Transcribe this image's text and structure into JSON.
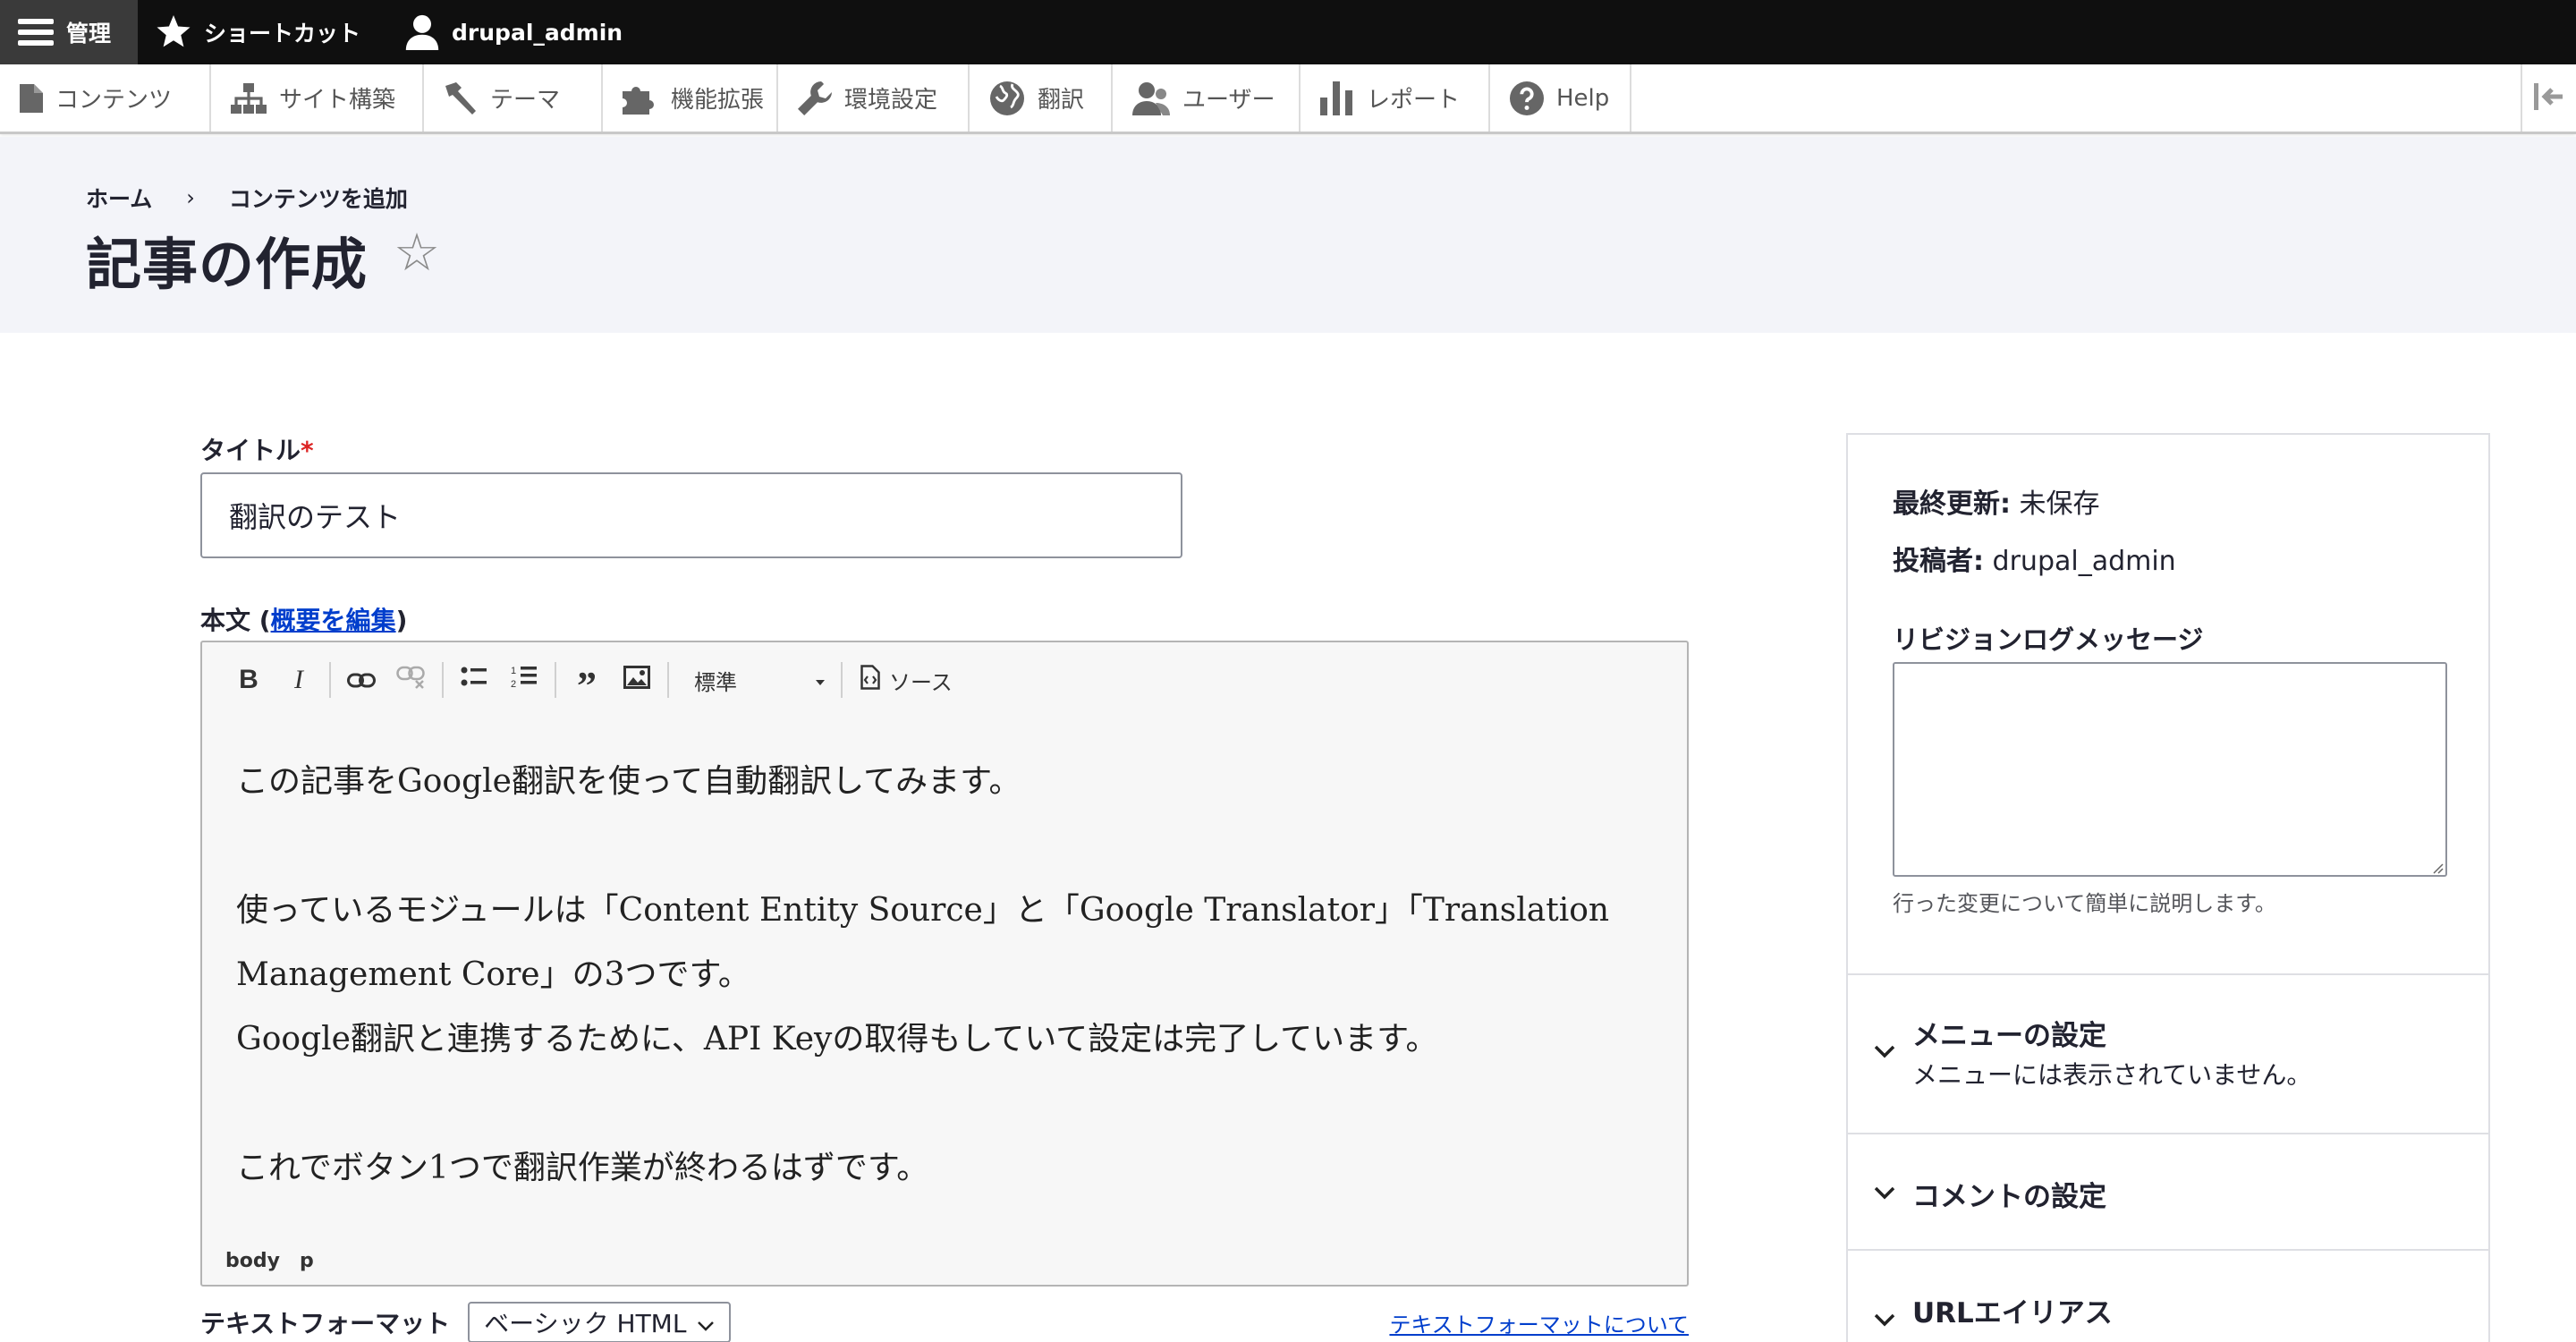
{
  "toolbar_bar": {
    "manage_label": "管理",
    "shortcuts_label": "ショートカット",
    "user_label": "drupal_admin"
  },
  "tray": {
    "items": [
      {
        "label": "コンテンツ",
        "icon": "file-icon"
      },
      {
        "label": "サイト構築",
        "icon": "sitemap-icon"
      },
      {
        "label": "テーマ",
        "icon": "paintbrush-icon"
      },
      {
        "label": "機能拡張",
        "icon": "puzzle-icon"
      },
      {
        "label": "環境設定",
        "icon": "wrench-icon"
      },
      {
        "label": "翻訳",
        "icon": "globe-icon"
      },
      {
        "label": "ユーザー",
        "icon": "people-icon"
      },
      {
        "label": "レポート",
        "icon": "bar-chart-icon"
      },
      {
        "label": "Help",
        "icon": "help-icon"
      }
    ]
  },
  "header": {
    "breadcrumb": [
      "ホーム",
      "コンテンツを追加"
    ],
    "breadcrumb_sep": "›",
    "title": "記事の作成",
    "star": "☆"
  },
  "form": {
    "title_label": "タイトル",
    "required_mark": "*",
    "title_value": "翻訳のテスト",
    "body_label_prefix": "本文 (",
    "body_label_link": "概要を編集",
    "body_label_suffix": ")",
    "editor": {
      "heading_select": "標準",
      "source_label": "ソース",
      "paragraphs": [
        "この記事をGoogle翻訳を使って自動翻訳してみます。",
        "使っているモジュールは「Content Entity Source」と「Google Translator」「Translation Management Core」の3つです。",
        "Google翻訳と連携するために、API Keyの取得もしていて設定は完了しています。",
        "これでボタン1つで翻訳作業が終わるはずです。"
      ],
      "status_path": [
        "body",
        "p"
      ]
    },
    "format_label": "テキストフォーマット",
    "format_value": "ベーシック HTML",
    "format_help_link": "テキストフォーマットについて"
  },
  "sidebar": {
    "last_updated_label": "最終更新:",
    "last_updated_value": "未保存",
    "author_label": "投稿者:",
    "author_value": "drupal_admin",
    "revision_label": "リビジョンログメッセージ",
    "revision_help": "行った変更について簡単に説明します。",
    "sections": [
      {
        "title": "メニューの設定",
        "summary": "メニューには表示されていません。"
      },
      {
        "title": "コメントの設定",
        "summary": ""
      },
      {
        "title": "URLエイリアス",
        "summary": ""
      }
    ]
  },
  "colors": {
    "admin_bar": "#0f0f0f",
    "header_bg": "#f3f4f9",
    "link": "#003ecc",
    "required": "#dc2323"
  }
}
